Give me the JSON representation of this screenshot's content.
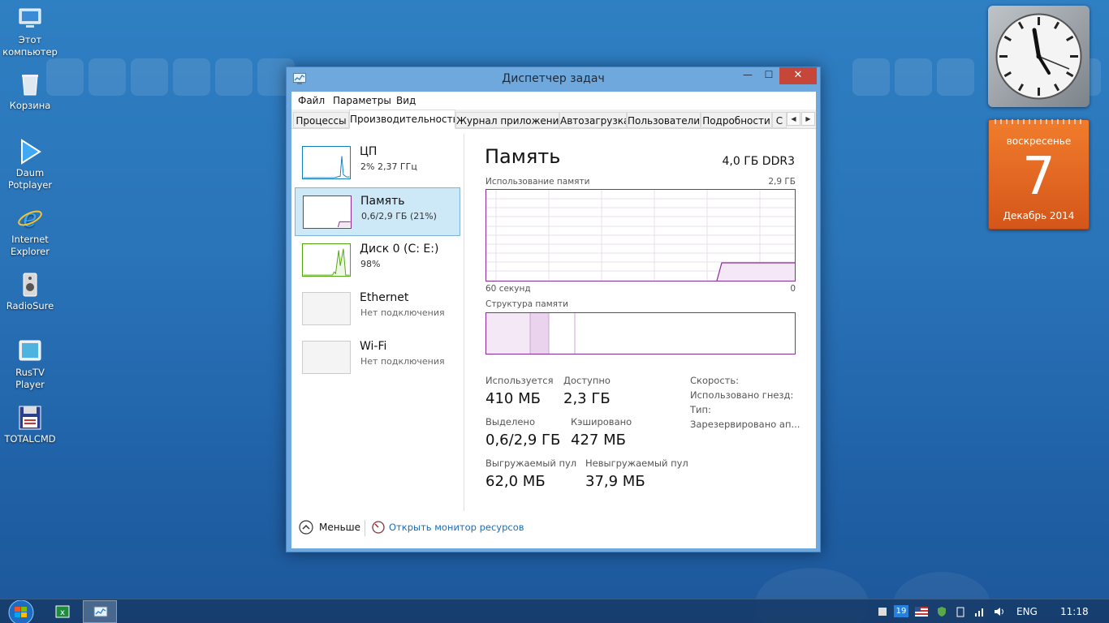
{
  "desktop": {
    "icons": [
      {
        "label_line1": "Этот",
        "label_line2": "компьютер"
      },
      {
        "label_line1": "Корзина",
        "label_line2": ""
      },
      {
        "label_line1": "Daum",
        "label_line2": "Potplayer"
      },
      {
        "label_line1": "Internet",
        "label_line2": "Explorer"
      },
      {
        "label_line1": "RadioSure",
        "label_line2": ""
      },
      {
        "label_line1": "RusTV Player",
        "label_line2": ""
      },
      {
        "label_line1": "TOTALCMD",
        "label_line2": ""
      }
    ]
  },
  "window": {
    "title": "Диспетчер задач",
    "controls": {
      "minimize": "—",
      "maximize": "☐",
      "close": "✕"
    },
    "menu": [
      "Файл",
      "Параметры",
      "Вид"
    ],
    "tabs": [
      "Процессы",
      "Производительность",
      "Журнал приложений",
      "Автозагрузка",
      "Пользователи",
      "Подробности",
      "С"
    ],
    "active_tab": "Производительность",
    "tab_scroll": {
      "left": "◀",
      "right": "▶"
    }
  },
  "perf_list": [
    {
      "name": "ЦП",
      "sub": "2% 2,37 ГГц"
    },
    {
      "name": "Память",
      "sub": "0,6/2,9 ГБ (21%)"
    },
    {
      "name": "Диск 0 (C: E:)",
      "sub": "98%"
    },
    {
      "name": "Ethernet",
      "sub": "Нет подключения"
    },
    {
      "name": "Wi-Fi",
      "sub": "Нет подключения"
    }
  ],
  "memory": {
    "title": "Память",
    "spec": "4,0 ГБ DDR3",
    "usage_label": "Использование памяти",
    "usage_max": "2,9 ГБ",
    "axis_left": "60 секунд",
    "axis_right": "0",
    "structure_label": "Структура памяти",
    "stats": {
      "in_use_label": "Используется",
      "in_use": "410 МБ",
      "available_label": "Доступно",
      "available": "2,3 ГБ",
      "committed_label": "Выделено",
      "committed": "0,6/2,9 ГБ",
      "cached_label": "Кэшировано",
      "cached": "427 МБ",
      "paged_label": "Выгружаемый пул",
      "paged": "62,0 МБ",
      "nonpaged_label": "Невыгружаемый пул",
      "nonpaged": "37,9 МБ"
    },
    "details": {
      "speed": "Скорость:",
      "slots": "Использовано гнезд:",
      "type": "Тип:",
      "reserved": "Зарезервировано ап..."
    }
  },
  "footer": {
    "less": "Меньше",
    "resource_monitor": "Открыть монитор ресурсов"
  },
  "calendar": {
    "weekday": "воскресенье",
    "day": "7",
    "month_year": "Декабрь 2014"
  },
  "taskbar": {
    "tray_badge": "19",
    "language": "ENG",
    "time": "11:18"
  },
  "colors": {
    "memory_accent": "#8b2b9a",
    "cpu_accent": "#117dbb",
    "disk_accent": "#4da60c",
    "close_button": "#c7463a",
    "link": "#1f6db3",
    "calendar": "#e8662a"
  }
}
